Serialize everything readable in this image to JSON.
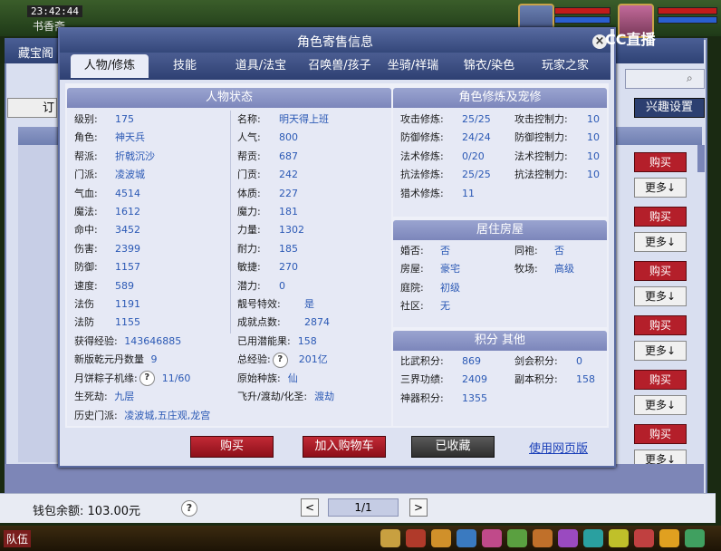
{
  "game": {
    "clock": "23:42:44",
    "place": "书香斋",
    "side_label": "藏宝阁",
    "side_btn": "订",
    "taskbar_team": "队伍"
  },
  "back_window": {
    "right_button": "兴趣设置",
    "buy_label": "购买",
    "more_label": "更多↓",
    "wallet_label": "钱包余额:",
    "wallet_value": "103.00元",
    "page": "1/1",
    "prev": "<",
    "next": ">",
    "brand": "CC直播"
  },
  "dialog": {
    "title": "角色寄售信息",
    "close": "×",
    "tabs": [
      "人物/修炼",
      "技能",
      "道具/法宝",
      "召唤兽/孩子",
      "坐骑/祥瑞",
      "锦衣/染色",
      "玩家之家"
    ],
    "active_tab": 0,
    "status": {
      "title": "人物状态",
      "left": [
        {
          "label": "级别:",
          "value": "175"
        },
        {
          "label": "角色:",
          "value": "神天兵"
        },
        {
          "label": "帮派:",
          "value": "折戟沉沙"
        },
        {
          "label": "门派:",
          "value": "凌波城"
        },
        {
          "label": "气血:",
          "value": "4514"
        },
        {
          "label": "魔法:",
          "value": "1612"
        },
        {
          "label": "命中:",
          "value": "3452"
        },
        {
          "label": "伤害:",
          "value": "2399"
        },
        {
          "label": "防御:",
          "value": "1157"
        },
        {
          "label": "速度:",
          "value": "589"
        },
        {
          "label": "法伤",
          "value": "1191"
        },
        {
          "label": "法防",
          "value": "1155"
        }
      ],
      "right": [
        {
          "label": "名称:",
          "value": "明天得上班"
        },
        {
          "label": "人气:",
          "value": "800"
        },
        {
          "label": "帮贡:",
          "value": "687"
        },
        {
          "label": "门贡:",
          "value": "242"
        },
        {
          "label": "体质:",
          "value": "227"
        },
        {
          "label": "魔力:",
          "value": "181"
        },
        {
          "label": "力量:",
          "value": "1302"
        },
        {
          "label": "耐力:",
          "value": "185"
        },
        {
          "label": "敏捷:",
          "value": "270"
        },
        {
          "label": "潜力:",
          "value": "0"
        },
        {
          "label": "靓号特效:",
          "value": "是"
        },
        {
          "label": "成就点数:",
          "value": "2874"
        }
      ],
      "bottom": [
        {
          "l1": "获得经验:",
          "v1": "143646885",
          "l2": "已用潜能果:",
          "v2": "158",
          "q1": false,
          "q2": false
        },
        {
          "l1": "新版乾元丹数量",
          "v1": "9",
          "l2": "总经验:",
          "v2": "201亿",
          "q1": false,
          "q2": true
        },
        {
          "l1": "月饼粽子机缘:",
          "v1": "11/60",
          "l2": "原始种族:",
          "v2": "仙",
          "q1": true,
          "q2": false
        },
        {
          "l1": "生死劫:",
          "v1": "九层",
          "l2": "飞升/渡劫/化圣:",
          "v2": "渡劫",
          "q1": false,
          "q2": false
        },
        {
          "l1": "历史门派:",
          "v1": "凌波城,五庄观,龙宫",
          "l2": "",
          "v2": "",
          "q1": false,
          "q2": false
        }
      ]
    },
    "cultivation": {
      "title": "角色修炼及宠修",
      "rows": [
        {
          "l1": "攻击修炼:",
          "v1": "25/25",
          "l2": "攻击控制力:",
          "v2": "10"
        },
        {
          "l1": "防御修炼:",
          "v1": "24/24",
          "l2": "防御控制力:",
          "v2": "10"
        },
        {
          "l1": "法术修炼:",
          "v1": "0/20",
          "l2": "法术控制力:",
          "v2": "10"
        },
        {
          "l1": "抗法修炼:",
          "v1": "25/25",
          "l2": "抗法控制力:",
          "v2": "10"
        },
        {
          "l1": "猎术修炼:",
          "v1": "11",
          "l2": "",
          "v2": ""
        }
      ]
    },
    "housing": {
      "title": "居住房屋",
      "rows": [
        {
          "l1": "婚否:",
          "v1": "否",
          "l2": "同袍:",
          "v2": "否"
        },
        {
          "l1": "房屋:",
          "v1": "豪宅",
          "l2": "牧场:",
          "v2": "高级"
        },
        {
          "l1": "庭院:",
          "v1": "初级",
          "l2": "",
          "v2": ""
        },
        {
          "l1": "社区:",
          "v1": "无",
          "l2": "",
          "v2": ""
        }
      ]
    },
    "points": {
      "title": "积分 其他",
      "rows": [
        {
          "l1": "比武积分:",
          "v1": "869",
          "l2": "剑会积分:",
          "v2": "0"
        },
        {
          "l1": "三界功绩:",
          "v1": "2409",
          "l2": "副本积分:",
          "v2": "158"
        },
        {
          "l1": "神器积分:",
          "v1": "1355",
          "l2": "",
          "v2": ""
        }
      ]
    },
    "buttons": {
      "buy": "购买",
      "cart": "加入购物车",
      "favorited": "已收藏",
      "web": "使用网页版"
    }
  }
}
